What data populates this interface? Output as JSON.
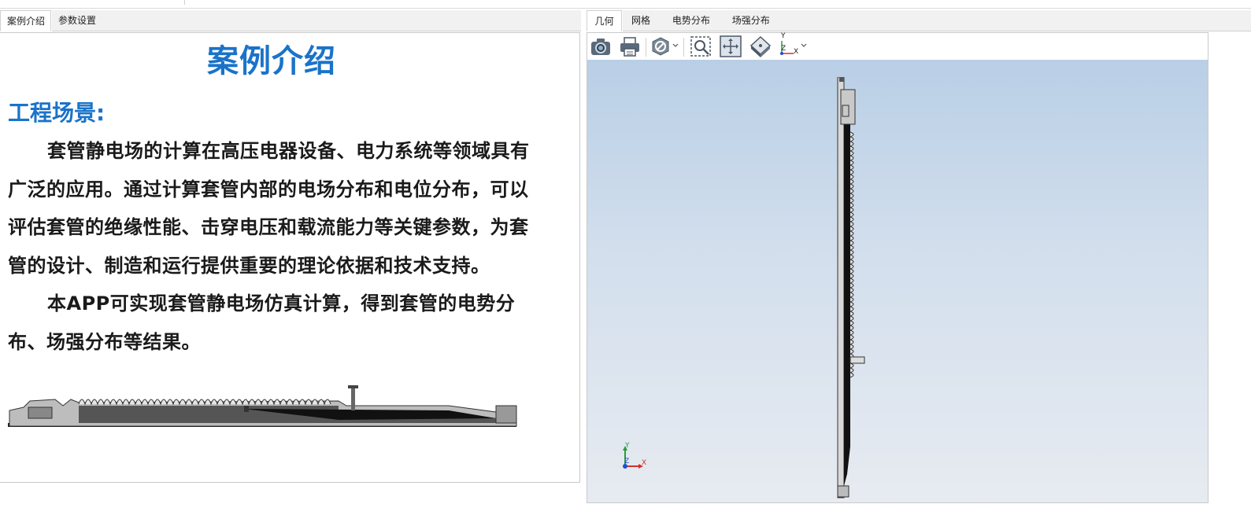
{
  "left_tabs": [
    {
      "label": "案例介绍",
      "active": true
    },
    {
      "label": "参数设置",
      "active": false
    }
  ],
  "right_tabs": [
    {
      "label": "几何",
      "active": true
    },
    {
      "label": "网格",
      "active": false
    },
    {
      "label": "电势分布",
      "active": false
    },
    {
      "label": "场强分布",
      "active": false
    }
  ],
  "doc": {
    "title": "案例介绍",
    "section_heading": "工程场景:",
    "paragraph1": "套管静电场的计算在高压电器设备、电力系统等领域具有广泛的应用。通过计算套管内部的电场分布和电位分布，可以评估套管的绝缘性能、击穿电压和载流能力等关键参数，为套管的设计、制造和运行提供重要的理论依据和技术支持。",
    "paragraph2": "本APP可实现套管静电场仿真计算，得到套管的电势分布、场强分布等结果。"
  },
  "toolbar": {
    "buttons": [
      "camera-icon",
      "print-icon",
      "hide-icon",
      "zoom-box-icon",
      "zoom-extents-icon",
      "view-plane-icon",
      "axis-orientation-icon"
    ]
  },
  "viewer": {
    "triad_labels": {
      "y": "Y",
      "z": "Z",
      "x": "X"
    },
    "toolbar_axis_labels": {
      "y": "Y",
      "z": "Z",
      "x": "X"
    }
  },
  "colors": {
    "accent_blue": "#1a73c9",
    "canvas_top": "#b9cfe6",
    "canvas_bottom": "#e7ebf1"
  }
}
